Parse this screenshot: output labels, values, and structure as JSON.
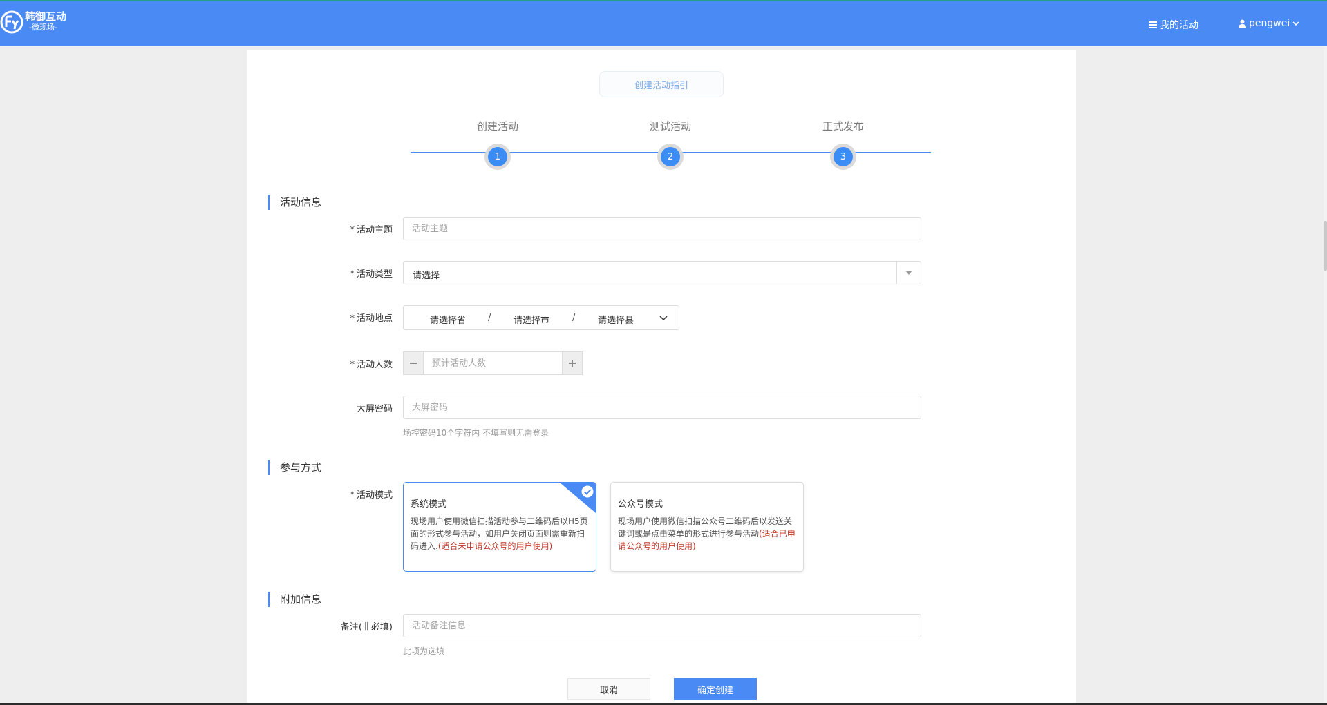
{
  "header": {
    "brand_title": "韩御互动",
    "brand_sub": "-微现场-",
    "nav_activities": "我的活动",
    "nav_user": "pengwei",
    "brand_color": "#4a8af4"
  },
  "guide": {
    "label": "创建活动指引"
  },
  "steps": [
    {
      "label": "创建活动",
      "number": "1"
    },
    {
      "label": "测试活动",
      "number": "2"
    },
    {
      "label": "正式发布",
      "number": "3"
    }
  ],
  "sections": {
    "info": "活动信息",
    "participation": "参与方式",
    "extra": "附加信息"
  },
  "fields": {
    "theme": {
      "label": "活动主题",
      "placeholder": "活动主题"
    },
    "type": {
      "label": "活动类型",
      "value": "请选择"
    },
    "location": {
      "label": "活动地点",
      "province": "请选择省",
      "city": "请选择市",
      "county": "请选择县",
      "separator": "/"
    },
    "people": {
      "label": "活动人数",
      "placeholder": "预计活动人数"
    },
    "password": {
      "label": "大屏密码",
      "placeholder": "大屏密码",
      "help": "场控密码10个字符内 不填写则无需登录"
    },
    "mode": {
      "label": "活动模式"
    },
    "remark": {
      "label": "备注(非必填)",
      "placeholder": "活动备注信息",
      "help": "此项为选填"
    }
  },
  "required_mark": "*",
  "modes": [
    {
      "title": "系统模式",
      "desc": "现场用户使用微信扫描活动参与二维码后以H5页面的形式参与活动，如用户关闭页面则需重新扫码进入.",
      "note": "(适合未申请公众号的用户使用)",
      "selected": true
    },
    {
      "title": "公众号模式",
      "desc": "现场用户使用微信扫描公众号二维码后以发送关键词或是点击菜单的形式进行参与活动",
      "note": "(适合已申请公众号的用户使用)",
      "selected": false
    }
  ],
  "actions": {
    "cancel": "取消",
    "confirm": "确定创建"
  }
}
